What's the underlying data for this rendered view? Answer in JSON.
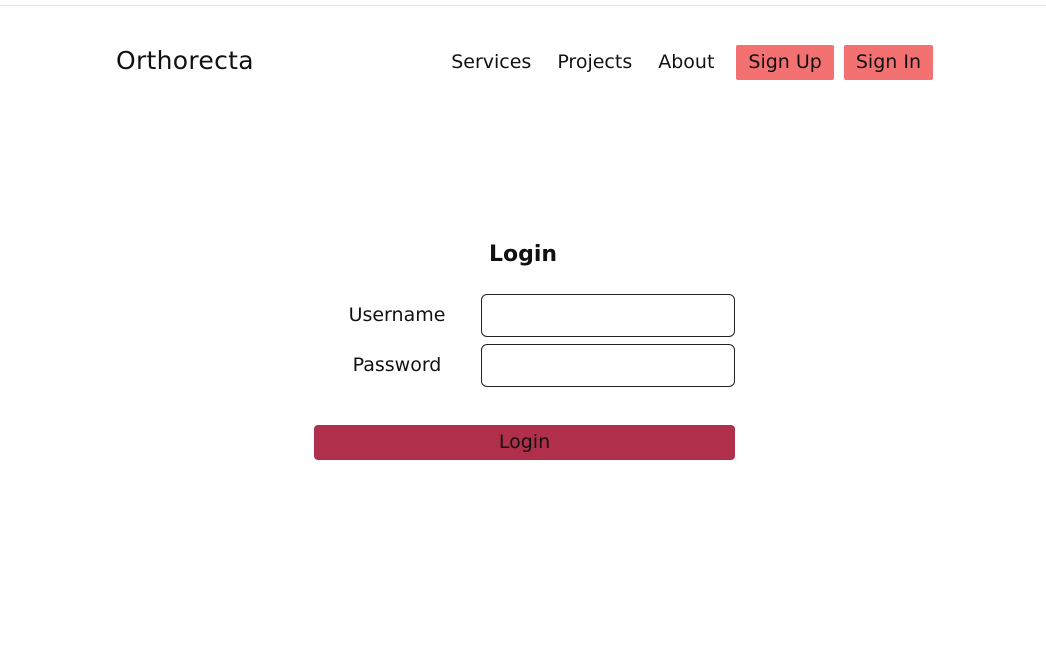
{
  "header": {
    "brand": "Orthorecta",
    "nav_links": [
      "Services",
      "Projects",
      "About"
    ],
    "sign_up_label": "Sign Up",
    "sign_in_label": "Sign In",
    "accent_color": "#f47171"
  },
  "form": {
    "title": "Login",
    "username_label": "Username",
    "username_value": "",
    "password_label": "Password",
    "password_value": "",
    "submit_label": "Login",
    "submit_color": "#b0304c"
  }
}
